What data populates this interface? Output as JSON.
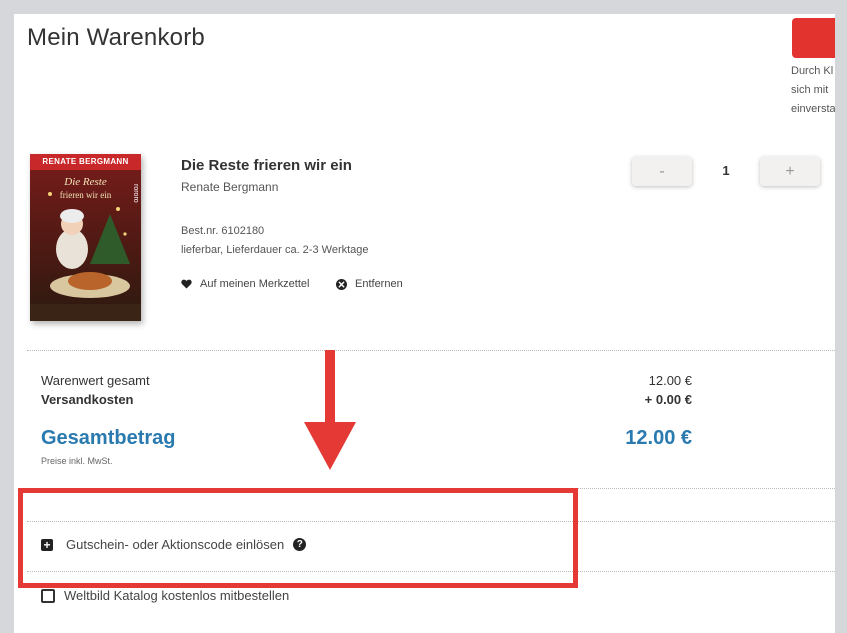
{
  "page": {
    "title": "Mein Warenkorb",
    "right_note_lines": [
      "Durch Kl",
      "sich mit",
      "einversta"
    ]
  },
  "product": {
    "title": "Die Reste frieren wir ein",
    "author": "Renate Bergmann",
    "order_number": "Best.nr. 6102180",
    "availability": "lieferbar, Lieferdauer ca. 2-3 Werktage",
    "wishlist_label": "Auf meinen Merkzettel",
    "remove_label": "Entfernen",
    "quantity": "1",
    "minus_label": "-",
    "plus_label": "+",
    "cover": {
      "author_line": "RENATE BERGMANN",
      "title_line1": "Die Reste",
      "title_line2": "frieren wir ein",
      "brand": "rororo"
    }
  },
  "summary": {
    "goods_label": "Warenwert gesamt",
    "goods_value": "12.00 €",
    "shipping_label": "Versandkosten",
    "shipping_value": "+ 0.00 €",
    "total_label": "Gesamtbetrag",
    "total_value": "12.00 €",
    "tax_note": "Preise inkl. MwSt."
  },
  "options": {
    "coupon_label": "Gutschein- oder Aktionscode einlösen",
    "coupon_plus": "+",
    "help_symbol": "?",
    "catalog_label": "Weltbild Katalog kostenlos mitbestellen"
  },
  "colors": {
    "accent": "#2a7ab0",
    "highlight": "#e53935",
    "checkout_button": "#e2332f"
  }
}
